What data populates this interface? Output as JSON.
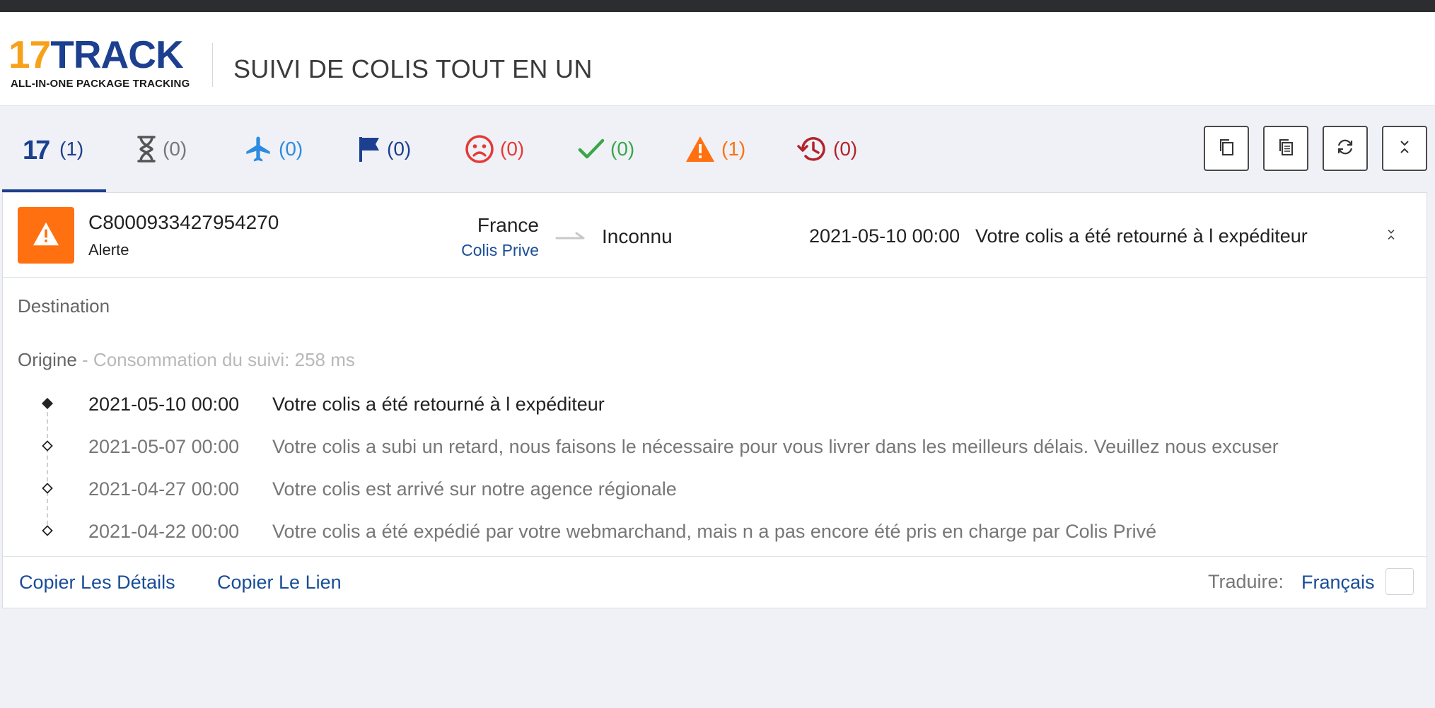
{
  "header": {
    "logo_number": "17",
    "logo_word": "TRACK",
    "logo_tagline": "ALL-IN-ONE PACKAGE TRACKING",
    "title": "SUIVI DE COLIS TOUT EN UN"
  },
  "tabs": [
    {
      "icon": "seventeen-logo-icon",
      "count": "(1)",
      "color": "#1d3f8f"
    },
    {
      "icon": "hourglass-icon",
      "count": "(0)",
      "color": "#555555"
    },
    {
      "icon": "airplane-icon",
      "count": "(0)",
      "color": "#2c8be0"
    },
    {
      "icon": "flag-icon",
      "count": "(0)",
      "color": "#1d3f8f"
    },
    {
      "icon": "sad-face-icon",
      "count": "(0)",
      "color": "#e53935"
    },
    {
      "icon": "checkmark-icon",
      "count": "(0)",
      "color": "#3aa64a"
    },
    {
      "icon": "warning-icon",
      "count": "(1)",
      "color": "#ff7010"
    },
    {
      "icon": "history-clock-icon",
      "count": "(0)",
      "color": "#b3232a"
    }
  ],
  "toolbar": {
    "buttons": [
      "copy-icon",
      "copy-list-icon",
      "refresh-icon",
      "collapse-all-icon"
    ]
  },
  "package": {
    "tracking_number": "C8000933427954270",
    "status": "Alerte",
    "origin_country": "France",
    "carrier": "Colis Prive",
    "destination_country": "Inconnu",
    "latest_date": "2021-05-10 00:00",
    "latest_message": "Votre colis a été retourné à l expéditeur"
  },
  "details": {
    "destination_label": "Destination",
    "origin_label": "Origine",
    "origin_meta": " - Consommation du suivi: 258 ms",
    "events": [
      {
        "date": "2021-05-10 00:00",
        "message": "Votre colis a été retourné à l expéditeur"
      },
      {
        "date": "2021-05-07 00:00",
        "message": "Votre colis a subi un retard, nous faisons le nécessaire pour vous livrer dans les meilleurs délais. Veuillez nous excuser"
      },
      {
        "date": "2021-04-27 00:00",
        "message": "Votre colis est arrivé sur notre agence régionale"
      },
      {
        "date": "2021-04-22 00:00",
        "message": "Votre colis a été expédié par votre webmarchand, mais n a pas encore été pris en charge par Colis Privé"
      }
    ]
  },
  "footer": {
    "copy_details": "Copier Les Détails",
    "copy_link": "Copier Le Lien",
    "translate_label": "Traduire:",
    "translate_language": "Français"
  },
  "colors": {
    "brand_blue": "#1d3f8f",
    "brand_orange": "#f7a11a",
    "alert_orange": "#ff7010",
    "link_blue": "#1a4d96"
  }
}
